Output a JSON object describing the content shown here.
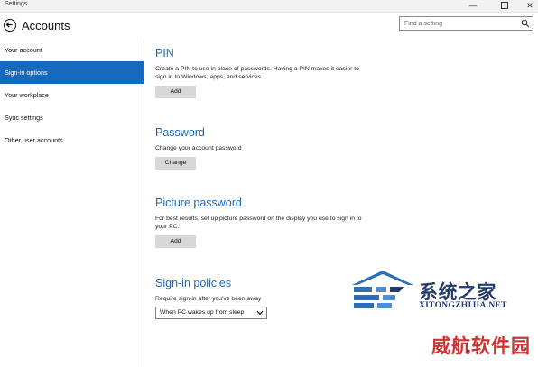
{
  "window": {
    "title": "Settings",
    "minimize_glyph": "—",
    "close_glyph": "✕"
  },
  "header": {
    "title": "Accounts",
    "search_placeholder": "Find a setting"
  },
  "sidebar": {
    "items": [
      {
        "label": "Your account",
        "active": false
      },
      {
        "label": "Sign-in options",
        "active": true
      },
      {
        "label": "Your workplace",
        "active": false
      },
      {
        "label": "Sync settings",
        "active": false
      },
      {
        "label": "Other user accounts",
        "active": false
      }
    ]
  },
  "main": {
    "pin": {
      "title": "PIN",
      "description": "Create a PIN to use in place of passwords. Having a PIN makes it easier to sign in to Windows, apps, and services.",
      "button": "Add"
    },
    "password": {
      "title": "Password",
      "description": "Change your account password",
      "button": "Change"
    },
    "picture_password": {
      "title": "Picture password",
      "description": "For best results, set up picture password on the display you use to sign in to your PC.",
      "button": "Add"
    },
    "signin_policies": {
      "title": "Sign-in policies",
      "description": "Require sign-in after you've been away",
      "selected": "When PC wakes up from sleep"
    }
  },
  "watermark": {
    "cn_text": "系统之家",
    "url": "XITONGZHIJIA.NET",
    "brand": "威航软件园"
  },
  "colors": {
    "accent": "#1769bd",
    "section_title": "#1c6ab8",
    "button_bg": "#d7d7d7",
    "watermark_blue": "#233a6a",
    "watermark_red": "#d23131"
  }
}
